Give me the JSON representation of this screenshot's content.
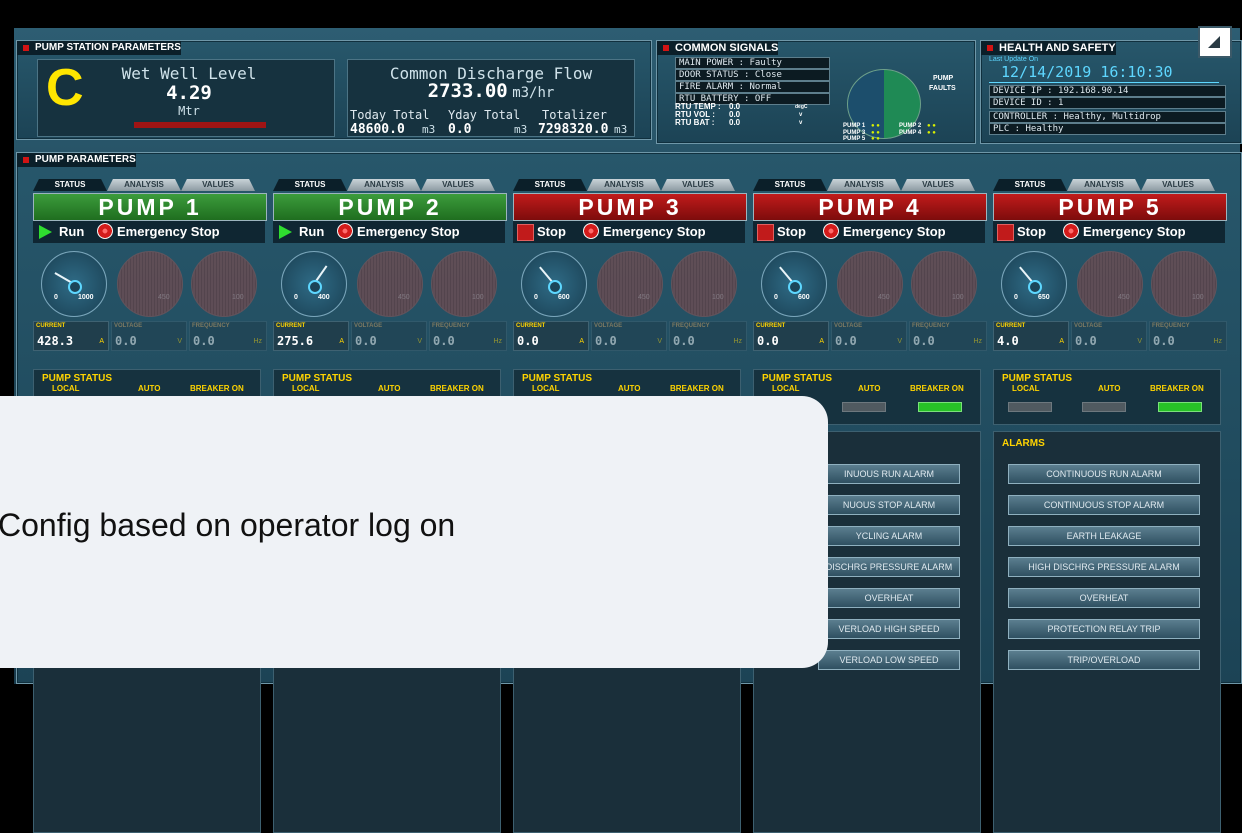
{
  "station": {
    "title": "PUMP STATION PARAMETERS",
    "level_letter": "C",
    "level_label": "Wet Well Level",
    "level_value": "4.29",
    "level_unit": "Mtr",
    "flow_label": "Common Discharge Flow",
    "flow_value": "2733.00",
    "flow_unit": "m3/hr",
    "today_label": "Today Total",
    "today_value": "48600.0",
    "yday_label": "Yday Total",
    "yday_value": "0.0",
    "totalizer_label": "Totalizer",
    "totalizer_value": "7298320.0",
    "m3": "m3"
  },
  "common": {
    "title": "COMMON SIGNALS",
    "signals": [
      "MAIN POWER : Faulty",
      "DOOR STATUS : Close",
      "FIRE ALARM : Normal",
      "RTU BATTERY : OFF"
    ],
    "rtu_temp_label": "RTU TEMP :",
    "rtu_temp_value": "0.0",
    "rtu_temp_unit": "degC",
    "rtu_vol_label": "RTU VOL :",
    "rtu_vol_value": "0.0",
    "rtu_vol_unit": "v",
    "rtu_bat_label": "RTU BAT :",
    "rtu_bat_value": "0.0",
    "rtu_bat_unit": "v",
    "faults_label_1": "PUMP",
    "faults_label_2": "FAULTS",
    "legend": [
      "PUMP 1",
      "PUMP 2",
      "PUMP 3",
      "PUMP 4",
      "PUMP 5"
    ]
  },
  "health": {
    "title": "HEALTH AND SAFETY",
    "last_update_label": "Last Update On",
    "datetime": "12/14/2019 16:10:30",
    "rows": [
      "DEVICE IP : 192.168.90.14",
      "DEVICE ID : 1",
      "CONTROLLER : Healthy, Multidrop",
      "PLC : Healthy"
    ]
  },
  "pumps_panel": {
    "title": "PUMP PARAMETERS",
    "tab_status": "STATUS",
    "tab_analysis": "ANALYSIS",
    "tab_values": "VALUES",
    "current_label": "CURRENT",
    "voltage_label": "VOLTAGE",
    "frequency_label": "FREQUENCY",
    "unit_a": "A",
    "unit_v": "V",
    "unit_hz": "Hz",
    "status_heading": "PUMP STATUS",
    "local": "LOCAL",
    "auto": "AUTO",
    "breaker": "BREAKER ON",
    "alarms_heading": "ALARMS",
    "estop": "Emergency Stop"
  },
  "pumps": [
    {
      "name": "PUMP 1",
      "state": "Run",
      "gauge_min": "0",
      "gauge_max": "1000",
      "current": "428.3",
      "voltage": "0.0",
      "frequency": "0.0",
      "v_gauge_max": "450",
      "f_gauge_max": "100"
    },
    {
      "name": "PUMP 2",
      "state": "Run",
      "gauge_min": "0",
      "gauge_max": "400",
      "current": "275.6",
      "voltage": "0.0",
      "frequency": "0.0",
      "v_gauge_max": "450",
      "f_gauge_max": "100"
    },
    {
      "name": "PUMP 3",
      "state": "Stop",
      "gauge_min": "0",
      "gauge_max": "600",
      "current": "0.0",
      "voltage": "0.0",
      "frequency": "0.0",
      "v_gauge_max": "450",
      "f_gauge_max": "100"
    },
    {
      "name": "PUMP 4",
      "state": "Stop",
      "gauge_min": "0",
      "gauge_max": "600",
      "current": "0.0",
      "voltage": "0.0",
      "frequency": "0.0",
      "v_gauge_max": "450",
      "f_gauge_max": "100"
    },
    {
      "name": "PUMP 5",
      "state": "Stop",
      "gauge_min": "0",
      "gauge_max": "650",
      "current": "4.0",
      "voltage": "0.0",
      "frequency": "0.0",
      "v_gauge_max": "450",
      "f_gauge_max": "100"
    }
  ],
  "alarm_buttons_partial": [
    "INUOUS RUN ALARM",
    "NUOUS STOP ALARM",
    "YCLING ALARM",
    "DISCHRG PRESSURE ALARM",
    "OVERHEAT",
    "VERLOAD HIGH SPEED",
    "VERLOAD LOW SPEED"
  ],
  "alarm_buttons_p5": [
    "CONTINUOUS RUN ALARM",
    "CONTINUOUS STOP ALARM",
    "EARTH LEAKAGE",
    "HIGH DISCHRG PRESSURE ALARM",
    "OVERHEAT",
    "PROTECTION RELAY TRIP",
    "TRIP/OVERLOAD"
  ],
  "overlay_text": "Config based on operator log on",
  "colors": {
    "accent_red": "#c11b1b",
    "run_green": "#1f6e1f",
    "label_yellow": "#ffd400",
    "date_cyan": "#5ed7ff"
  }
}
